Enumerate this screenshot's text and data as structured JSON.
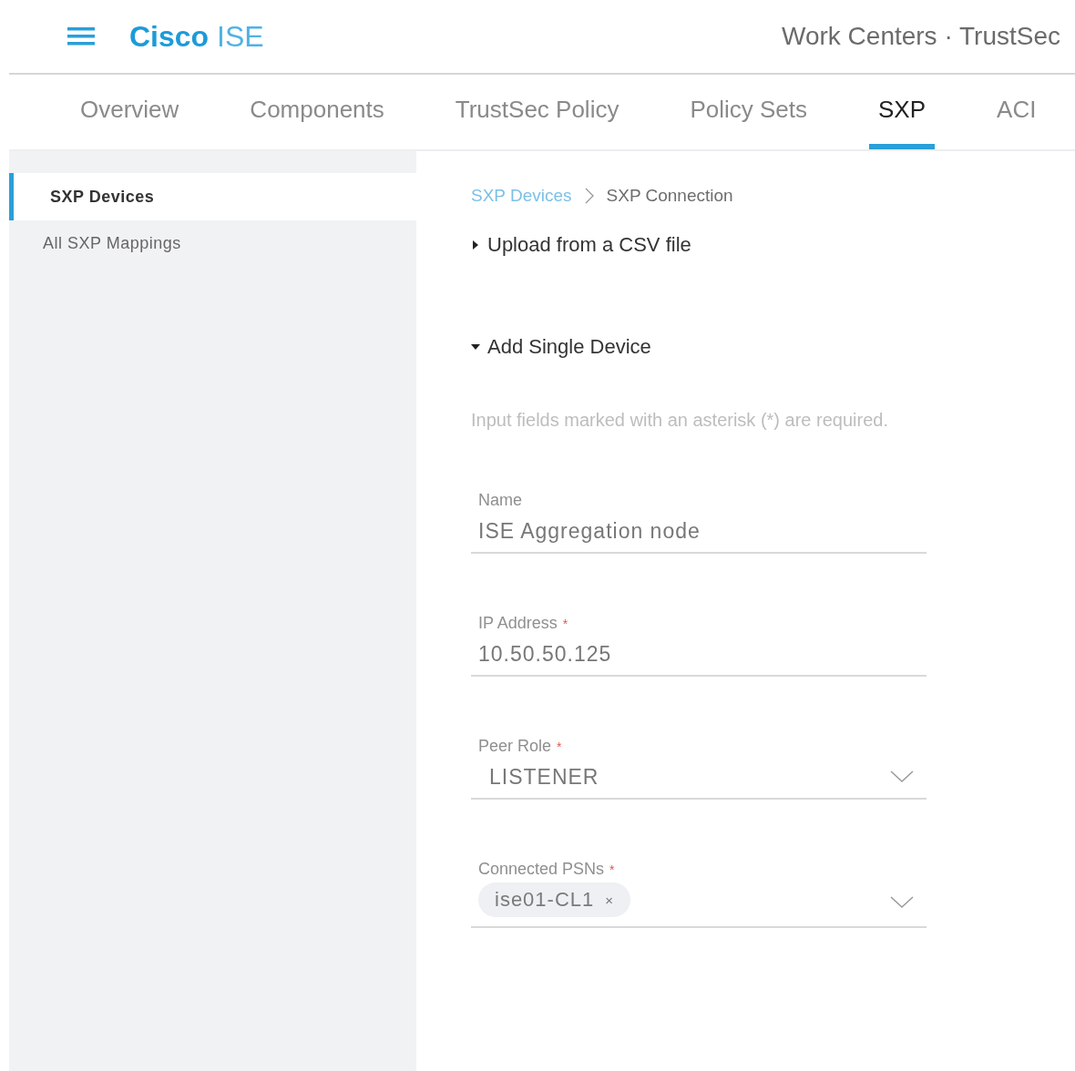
{
  "header": {
    "brand_bold": "Cisco",
    "brand_light": "ISE",
    "context": "Work Centers · TrustSec"
  },
  "tabs": [
    {
      "label": "Overview",
      "selected": false
    },
    {
      "label": "Components",
      "selected": false
    },
    {
      "label": "TrustSec Policy",
      "selected": false
    },
    {
      "label": "Policy Sets",
      "selected": false
    },
    {
      "label": "SXP",
      "selected": true
    },
    {
      "label": "ACI",
      "selected": false
    }
  ],
  "sidebar": {
    "items": [
      {
        "label": "SXP Devices",
        "selected": true
      },
      {
        "label": "All SXP Mappings",
        "selected": false
      }
    ]
  },
  "breadcrumb": [
    {
      "label": "SXP Devices",
      "kind": "link"
    },
    {
      "label": "SXP Connection",
      "kind": "current"
    }
  ],
  "sections": [
    {
      "title": "Upload from a CSV file",
      "expanded": false
    },
    {
      "title": "Add Single Device",
      "expanded": true
    }
  ],
  "form": {
    "hint": "Input fields marked with an asterisk (*) are required.",
    "fields": [
      {
        "kind": "text",
        "label": "Name",
        "value": "ISE Aggregation node"
      },
      {
        "kind": "text",
        "label": "IP Address",
        "required_mark": "*",
        "value": "10.50.50.125"
      },
      {
        "kind": "select",
        "label": "Peer Role",
        "required_mark": "*",
        "value": "LISTENER"
      },
      {
        "kind": "multiselect",
        "label": "Connected PSNs",
        "required_mark": "*",
        "chips": [
          {
            "label": "ise01-CL1",
            "remove": "×"
          }
        ]
      }
    ]
  }
}
